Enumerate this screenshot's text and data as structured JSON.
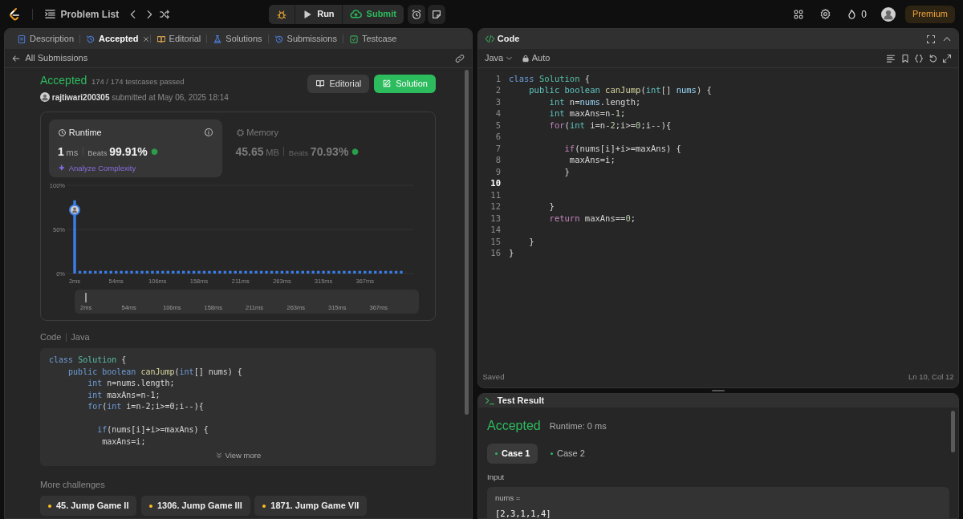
{
  "top_bar": {
    "title": "Problem List",
    "run": "Run",
    "submit": "Submit",
    "streak": "0",
    "premium": "Premium"
  },
  "left_panel": {
    "tabs": [
      {
        "label": "Description",
        "kind": "document",
        "selected": false,
        "closable": false
      },
      {
        "label": "Accepted",
        "kind": "history",
        "selected": true,
        "closable": true
      },
      {
        "label": "Editorial",
        "kind": "book",
        "selected": false,
        "closable": false
      },
      {
        "label": "Solutions",
        "kind": "flask",
        "selected": false,
        "closable": false
      },
      {
        "label": "Submissions",
        "kind": "history",
        "selected": false,
        "closable": false
      },
      {
        "label": "Testcase",
        "kind": "check",
        "selected": false,
        "closable": false
      }
    ],
    "back_link": "All Submissions",
    "submission": {
      "status": "Accepted",
      "testcases": "174 / 174 testcases passed",
      "user": "rajtiwari200305",
      "submitted": "submitted at May 06, 2025 18:14",
      "buttons": [
        {
          "label": "Editorial",
          "kind": "secondary"
        },
        {
          "label": "Solution",
          "kind": "primary"
        }
      ]
    },
    "stats": [
      {
        "title": "Runtime",
        "kind": "clock",
        "selected": true,
        "value": "1",
        "unit": "ms",
        "beats_label": "Beats",
        "beats": "99.91%",
        "link": "Analyze Complexity"
      },
      {
        "title": "Memory",
        "kind": "chip",
        "selected": false,
        "value": "45.65",
        "unit": "MB",
        "beats_label": "Beats",
        "beats": "70.93%"
      }
    ],
    "chart_data": {
      "type": "bar",
      "ylim": [
        0,
        100
      ],
      "yticks": [
        {
          "value": 0,
          "label": "0%"
        },
        {
          "value": 50,
          "label": "50%"
        },
        {
          "value": 100,
          "label": "100%"
        }
      ],
      "categories": [
        "2ms",
        null,
        null,
        null,
        null,
        null,
        null,
        null,
        "54ms",
        null,
        null,
        null,
        null,
        null,
        null,
        null,
        "106ms",
        null,
        null,
        null,
        null,
        null,
        null,
        null,
        "158ms",
        null,
        null,
        null,
        null,
        null,
        null,
        null,
        "211ms",
        null,
        null,
        null,
        null,
        null,
        null,
        null,
        "263ms",
        null,
        null,
        null,
        null,
        null,
        null,
        null,
        "315ms",
        null,
        null,
        null,
        null,
        null,
        null,
        null,
        "367ms",
        null,
        null,
        null,
        null,
        null,
        null,
        null
      ],
      "series": [
        {
          "color": "#3b7ee8",
          "values": [
            83,
            3,
            3,
            3,
            3,
            3,
            3,
            3,
            3,
            3,
            3,
            3,
            3,
            3,
            3,
            3,
            3,
            3,
            3,
            3,
            3,
            3,
            3,
            3,
            3,
            3,
            3,
            3,
            3,
            3,
            3,
            3,
            3,
            3,
            3,
            3,
            3,
            3,
            3,
            3,
            3,
            3,
            3,
            3,
            3,
            3,
            3,
            3,
            3,
            3,
            3,
            3,
            3,
            3,
            3,
            3,
            3,
            3,
            3,
            3,
            3,
            3,
            3,
            3
          ]
        }
      ]
    },
    "range_labels": [
      "2ms",
      "54ms",
      "106ms",
      "158ms",
      "211ms",
      "263ms",
      "315ms",
      "367ms"
    ],
    "code_header": {
      "title": "Code",
      "language": "Java"
    },
    "code_lines": [
      {
        "tokens": [
          {
            "text": "class",
            "kind": "kw"
          },
          {
            "text": " Solution",
            "kind": "ty"
          },
          {
            "text": " {",
            "kind": "pl"
          }
        ]
      },
      {
        "tokens": [
          {
            "text": "    public boolean",
            "kind": "kw"
          },
          {
            "text": " canJump",
            "kind": "fn"
          },
          {
            "text": "(",
            "kind": "pl"
          },
          {
            "text": "int",
            "kind": "kw"
          },
          {
            "text": "[] nums) {",
            "kind": "pl"
          }
        ]
      },
      {
        "tokens": [
          {
            "text": "        int",
            "kind": "kw"
          },
          {
            "text": " n=nums.length;",
            "kind": "pl"
          }
        ]
      },
      {
        "tokens": [
          {
            "text": "        int",
            "kind": "kw"
          },
          {
            "text": " maxAns=n-1;",
            "kind": "pl"
          }
        ]
      },
      {
        "tokens": [
          {
            "text": "        for",
            "kind": "kw"
          },
          {
            "text": "(",
            "kind": "pl"
          },
          {
            "text": "int",
            "kind": "kw"
          },
          {
            "text": " i=n-2;i>=0;i--){",
            "kind": "pl"
          }
        ]
      },
      {
        "gap_before": true,
        "tokens": [
          {
            "text": "          if",
            "kind": "kw"
          },
          {
            "text": "(nums[i]+i>=maxAns) {",
            "kind": "pl"
          }
        ]
      },
      {
        "tokens": [
          {
            "text": "           maxAns=i;",
            "kind": "pl"
          }
        ]
      }
    ],
    "view_more": "View more",
    "more_challenges": {
      "title": "More challenges",
      "items": [
        "45. Jump Game II",
        "1306. Jump Game III",
        "1871. Jump Game VII"
      ]
    }
  },
  "code_panel": {
    "title": "Code",
    "language": "Java",
    "mode": "Auto",
    "lines": [
      {
        "number": "1",
        "current": false,
        "tokens": [
          {
            "text": "class",
            "kind": "kw"
          },
          {
            "text": " Solution",
            "kind": "ty"
          },
          {
            "text": " {",
            "kind": "pl"
          }
        ]
      },
      {
        "number": "2",
        "current": false,
        "tokens": [
          {
            "text": "    public boolean",
            "kind": "ek"
          },
          {
            "text": " canJump",
            "kind": "fn"
          },
          {
            "text": "(",
            "kind": "pl"
          },
          {
            "text": "int",
            "kind": "ek"
          },
          {
            "text": "[]",
            "kind": "pl"
          },
          {
            "text": " nums",
            "kind": "vr"
          },
          {
            "text": ") {",
            "kind": "pl"
          }
        ]
      },
      {
        "number": "3",
        "current": false,
        "tokens": [
          {
            "text": "        int",
            "kind": "ek"
          },
          {
            "text": " n=",
            "kind": "pl"
          },
          {
            "text": "nums",
            "kind": "vr"
          },
          {
            "text": ".length;",
            "kind": "pl"
          }
        ]
      },
      {
        "number": "4",
        "current": false,
        "tokens": [
          {
            "text": "        int",
            "kind": "ek"
          },
          {
            "text": " maxAns=n-",
            "kind": "pl"
          },
          {
            "text": "1",
            "kind": "num"
          },
          {
            "text": ";",
            "kind": "pl"
          }
        ]
      },
      {
        "number": "5",
        "current": false,
        "tokens": [
          {
            "text": "        for",
            "kind": "ctl"
          },
          {
            "text": "(",
            "kind": "pl"
          },
          {
            "text": "int",
            "kind": "ek"
          },
          {
            "text": " i=n-",
            "kind": "pl"
          },
          {
            "text": "2",
            "kind": "num"
          },
          {
            "text": ";i>=",
            "kind": "pl"
          },
          {
            "text": "0",
            "kind": "num"
          },
          {
            "text": ";i--){",
            "kind": "pl"
          }
        ]
      },
      {
        "number": "6",
        "current": false
      },
      {
        "number": "7",
        "current": false,
        "tokens": [
          {
            "text": "           if",
            "kind": "ctl"
          },
          {
            "text": "(nums[i]+i>=maxAns) {",
            "kind": "pl"
          }
        ]
      },
      {
        "number": "8",
        "current": false,
        "tokens": [
          {
            "text": "            maxAns=i;",
            "kind": "pl"
          }
        ]
      },
      {
        "number": "9",
        "current": false,
        "tokens": [
          {
            "text": "           }",
            "kind": "pl"
          }
        ]
      },
      {
        "number": "10",
        "current": true
      },
      {
        "number": "11",
        "current": false
      },
      {
        "number": "12",
        "current": false,
        "tokens": [
          {
            "text": "        }",
            "kind": "pl"
          }
        ]
      },
      {
        "number": "13",
        "current": false,
        "tokens": [
          {
            "text": "        return",
            "kind": "ctl"
          },
          {
            "text": " maxAns==",
            "kind": "pl"
          },
          {
            "text": "0",
            "kind": "num"
          },
          {
            "text": ";",
            "kind": "pl"
          }
        ]
      },
      {
        "number": "14",
        "current": false
      },
      {
        "number": "15",
        "current": false,
        "tokens": [
          {
            "text": "    }",
            "kind": "pl"
          }
        ]
      },
      {
        "number": "16",
        "current": false,
        "tokens": [
          {
            "text": "}",
            "kind": "pl"
          }
        ]
      }
    ],
    "status": "Saved",
    "cursor": "Ln 10, Col 12"
  },
  "test_result": {
    "title": "Test Result",
    "status": "Accepted",
    "runtime": "Runtime: 0 ms",
    "cases": [
      {
        "label": "Case 1",
        "selected": true
      },
      {
        "label": "Case 2",
        "selected": false
      }
    ],
    "input_label": "Input",
    "input_name": "nums =",
    "input_value": "[2,3,1,1,4]"
  }
}
